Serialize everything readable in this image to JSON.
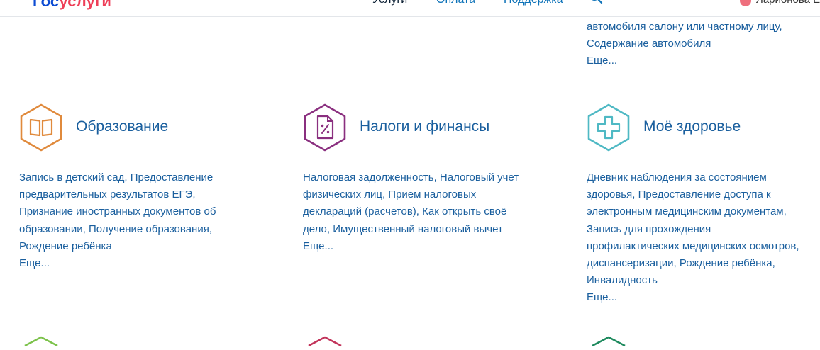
{
  "header": {
    "logo_part1": "Гос",
    "logo_part2": "услуги",
    "nav": {
      "services": "Услуги",
      "payment": "Оплата",
      "support": "Поддержка"
    },
    "user_name": "Ларионова Е."
  },
  "top_continuation": {
    "lines": [
      "автомобиля салону или частному лицу,",
      "Содержание автомобиля"
    ],
    "more": "Еще..."
  },
  "categories": [
    {
      "title": "Образование",
      "icon": "book-icon",
      "color": "#e08a3c",
      "lines": [
        "Запись в детский сад, Предоставление",
        "предварительных результатов ЕГЭ,",
        "Признание иностранных документов об",
        "образовании, Получение образования,",
        "Рождение ребёнка"
      ],
      "more": "Еще..."
    },
    {
      "title": "Налоги и финансы",
      "icon": "tax-document-icon",
      "color": "#8a2f7f",
      "lines": [
        "Налоговая задолженность, Налоговый учет",
        "физических лиц, Прием налоговых",
        "деклараций (расчетов), Как открыть своё",
        "дело, Имущественный налоговый вычет"
      ],
      "more": "Еще..."
    },
    {
      "title": "Моё здоровье",
      "icon": "medical-cross-icon",
      "color": "#4fb9c4",
      "lines": [
        "Дневник наблюдения за состоянием",
        "здоровья, Предоставление доступа к",
        "электронным медицинским документам,",
        "Запись для прохождения",
        "профилактических медицинских осмотров,",
        "диспансеризации, Рождение ребёнка,",
        "Инвалидность"
      ],
      "more": "Еще..."
    }
  ],
  "partial_row_colors": [
    "#7cc24b",
    "#c2335a",
    "#1e8a5e"
  ]
}
